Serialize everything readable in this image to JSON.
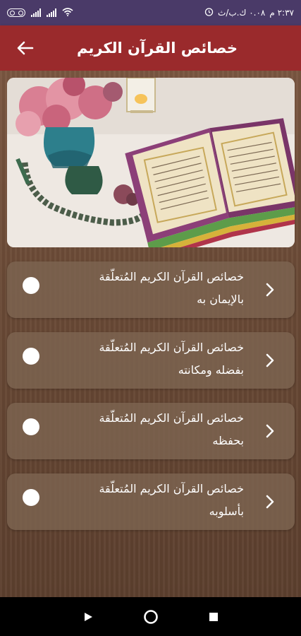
{
  "status_bar": {
    "time": "٢:٣٧ م",
    "speed": "٠.٠٨ ك.ب/ث"
  },
  "app_bar": {
    "title": "خصائص القرآن الكريم",
    "back_icon": "arrow-left-icon"
  },
  "hero": {
    "alt": "quran-photo"
  },
  "items": [
    {
      "line1": "خصائص القرآن الكريم المُتعلّقة",
      "line2": "بالإيمان به"
    },
    {
      "line1": "خصائص القرآن الكريم المُتعلّقة",
      "line2": "بفضله ومكانته"
    },
    {
      "line1": "خصائص القرآن الكريم المُتعلّقة",
      "line2": "بحفظه"
    },
    {
      "line1": "خصائص القرآن الكريم المُتعلّقة",
      "line2": "بأسلوبه"
    }
  ],
  "colors": {
    "status_bar": "#4a3a68",
    "app_bar": "#9a2a2c",
    "card": "#7d6450"
  },
  "nav": {
    "back": "triangle-back-icon",
    "home": "circle-home-icon",
    "recents": "square-recents-icon"
  }
}
